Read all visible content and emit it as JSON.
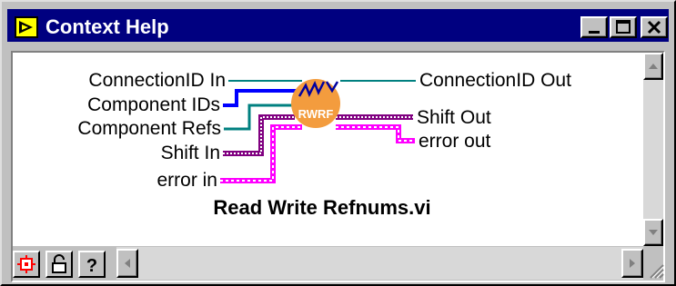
{
  "window": {
    "title": "Context Help"
  },
  "connector_pane": {
    "inputs": [
      "ConnectionID In",
      "Component IDs",
      "Component Refs",
      "Shift In",
      "error in"
    ],
    "outputs": [
      "ConnectionID Out",
      "Shift Out",
      "error out"
    ],
    "icon_text": "RWRF",
    "vi_name": "Read Write Refnums.vi"
  },
  "toolbar": {
    "buttons": [
      "diagram-icon",
      "lock-icon",
      "help-icon"
    ],
    "help_label": "?"
  },
  "colors": {
    "title_bar": "#000080",
    "refnum_wire": "#008080",
    "ids_wire": "#0000ff",
    "cluster_wire": "#ff00ff",
    "shift_wire": "#800080",
    "icon_fill": "#f39c3e"
  }
}
